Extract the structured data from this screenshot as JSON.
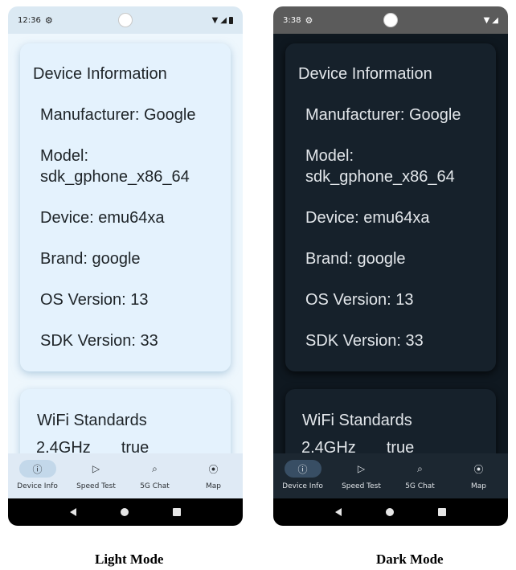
{
  "light_phone": {
    "status_time": "12:36",
    "card_title": "Device Information",
    "rows": {
      "manufacturer": "Manufacturer: Google",
      "model": "Model: sdk_gphone_x86_64",
      "device": "Device: emu64xa",
      "brand": "Brand: google",
      "os_version": "OS Version: 13",
      "sdk_version": "SDK Version: 33"
    },
    "wifi_title": "WiFi Standards",
    "wifi_band": "2.4GHz",
    "wifi_value": "true",
    "nav": {
      "device_info": "Device Info",
      "speed_test": "Speed Test",
      "chat": "5G Chat",
      "map": "Map"
    }
  },
  "dark_phone": {
    "status_time": "3:38",
    "card_title": "Device Information",
    "rows": {
      "manufacturer": "Manufacturer: Google",
      "model": "Model: sdk_gphone_x86_64",
      "device": "Device: emu64xa",
      "brand": "Brand: google",
      "os_version": "OS Version: 13",
      "sdk_version": "SDK Version: 33"
    },
    "wifi_title": "WiFi Standards",
    "wifi_band": "2.4GHz",
    "wifi_value": "true",
    "nav": {
      "device_info": "Device Info",
      "speed_test": "Speed Test",
      "chat": "5G Chat",
      "map": "Map"
    }
  },
  "captions": {
    "light": "Light Mode",
    "dark": "Dark Mode"
  },
  "icons": {
    "info": "info-icon",
    "speed": "play-icon",
    "chat": "search-icon",
    "map": "location-pin-icon"
  }
}
